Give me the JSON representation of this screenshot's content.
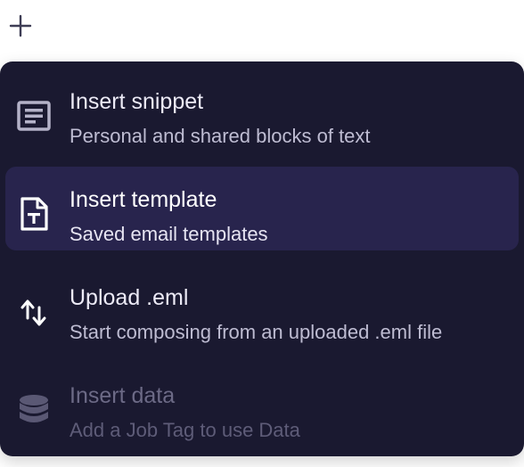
{
  "toolbar": {
    "add_icon": "plus-icon"
  },
  "menu": {
    "items": [
      {
        "title": "Insert snippet",
        "description": "Personal and shared blocks of text",
        "icon": "snippet-icon",
        "state": "normal"
      },
      {
        "title": "Insert template",
        "description": "Saved email templates",
        "icon": "template-document-icon",
        "state": "highlighted"
      },
      {
        "title": "Upload .eml",
        "description": "Start composing from an uploaded .eml file",
        "icon": "upload-arrows-icon",
        "state": "normal"
      },
      {
        "title": "Insert data",
        "description": "Add a Job Tag to use Data",
        "icon": "database-icon",
        "state": "disabled"
      }
    ]
  },
  "colors": {
    "menu_background": "#1a1930",
    "highlight_background": "#28244d",
    "text_primary": "#eceaf6",
    "text_secondary": "#bebcd2",
    "text_disabled": "#6c6a86"
  }
}
